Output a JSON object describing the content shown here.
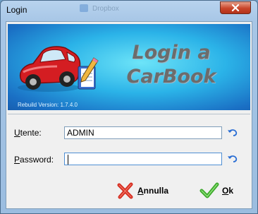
{
  "window": {
    "title": "Login",
    "background_tab": "Dropbox"
  },
  "banner": {
    "title_line1": "Login a",
    "title_line2": "CarBook",
    "version": "Rebuild Version: 1.7.4.0"
  },
  "form": {
    "username_label": "Utente:",
    "username_value": "ADMIN",
    "password_label": "Password:",
    "password_value": ""
  },
  "buttons": {
    "cancel_label": "Annulla",
    "ok_label": "Ok"
  },
  "colors": {
    "banner_gradient_center": "#6de4f8",
    "banner_gradient_edge": "#185fb0",
    "cancel_icon": "#d42a1e",
    "ok_icon": "#3ba82a",
    "reset_icon": "#2a6ed4"
  },
  "icons": {
    "close": "close-icon",
    "car": "car-icon",
    "reset": "undo-arrow-icon",
    "cancel": "red-x-icon",
    "ok": "green-check-icon"
  }
}
